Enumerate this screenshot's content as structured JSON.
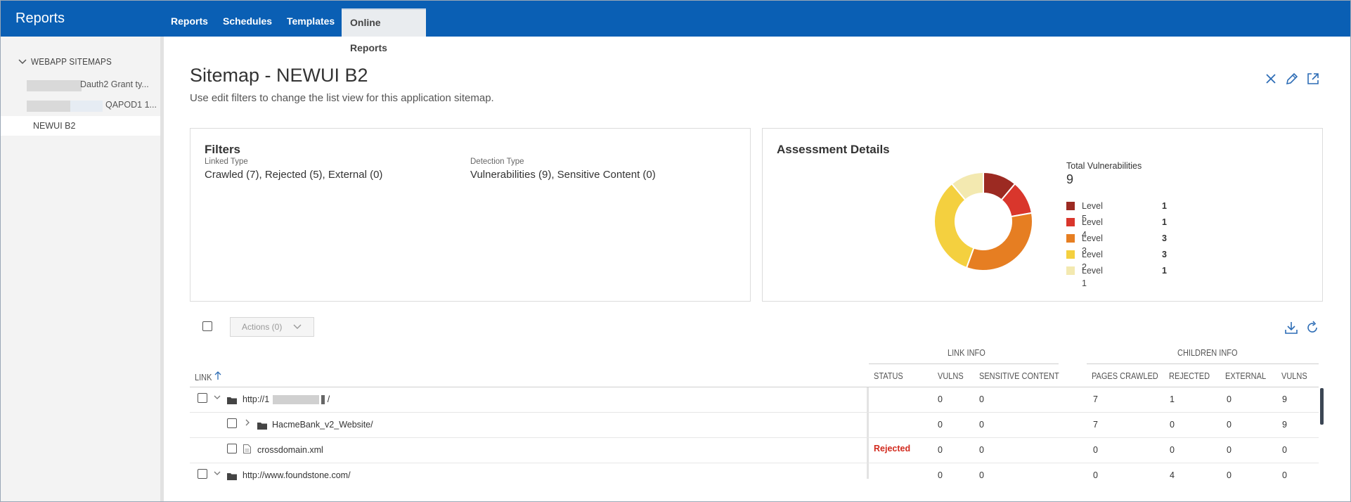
{
  "header": {
    "app_title": "Reports",
    "tabs": [
      {
        "label": "Reports"
      },
      {
        "label": "Schedules"
      },
      {
        "label": "Templates"
      },
      {
        "label": "Online Reports"
      }
    ]
  },
  "sidebar": {
    "section_title": "WEBAPP SITEMAPS",
    "items": [
      {
        "label": "Dauth2 Grant ty..."
      },
      {
        "label": "QAPOD1 1..."
      },
      {
        "label": "NEWUI B2"
      }
    ]
  },
  "main": {
    "title": "Sitemap - NEWUI B2",
    "subtitle": "Use edit filters to change the list view for this application sitemap.",
    "icons": [
      "close-icon",
      "edit-icon",
      "open-external-icon"
    ]
  },
  "filters": {
    "title": "Filters",
    "linked_type_label": "Linked Type",
    "linked_type_value": "Crawled (7),  Rejected (5),  External (0)",
    "detection_type_label": "Detection Type",
    "detection_type_value": "Vulnerabilities (9), Sensitive Content (0)"
  },
  "assessment": {
    "title": "Assessment Details",
    "total_label": "Total Vulnerabilities",
    "total_value": "9"
  },
  "chart_data": {
    "type": "pie",
    "donut": true,
    "categories": [
      "Level 5",
      "Level 4",
      "Level 3",
      "Level 2",
      "Level 1"
    ],
    "values": [
      1,
      1,
      3,
      3,
      1
    ],
    "colors": [
      "#9c2a22",
      "#d9362c",
      "#e67e22",
      "#f4d03f",
      "#f3e9b0"
    ],
    "legend_position": "right"
  },
  "toolbar": {
    "actions_label": "Actions (0)",
    "icons": [
      "download-icon",
      "refresh-icon"
    ]
  },
  "table": {
    "group_headers": {
      "link_info": "LINK INFO",
      "children_info": "CHILDREN INFO"
    },
    "columns": {
      "link": "LINK",
      "status": "STATUS",
      "vulns": "VULNS",
      "sensitive": "SENSITIVE CONTENT",
      "pages_crawled": "PAGES CRAWLED",
      "rejected": "REJECTED",
      "external": "EXTERNAL",
      "child_vulns": "VULNS"
    },
    "rows": [
      {
        "link": "http://1",
        "link_suffix": "/",
        "status": "",
        "vulns": "0",
        "sensitive": "0",
        "pages_crawled": "7",
        "rejected": "1",
        "external": "0",
        "child_vulns": "9"
      },
      {
        "link": "HacmeBank_v2_Website/",
        "link_suffix": "",
        "status": "",
        "vulns": "0",
        "sensitive": "0",
        "pages_crawled": "7",
        "rejected": "0",
        "external": "0",
        "child_vulns": "9"
      },
      {
        "link": "crossdomain.xml",
        "link_suffix": "",
        "status": "Rejected",
        "vulns": "0",
        "sensitive": "0",
        "pages_crawled": "0",
        "rejected": "0",
        "external": "0",
        "child_vulns": "0"
      },
      {
        "link": "http://www.foundstone.com/",
        "link_suffix": "",
        "status": "",
        "vulns": "0",
        "sensitive": "0",
        "pages_crawled": "0",
        "rejected": "4",
        "external": "0",
        "child_vulns": "0"
      }
    ]
  }
}
